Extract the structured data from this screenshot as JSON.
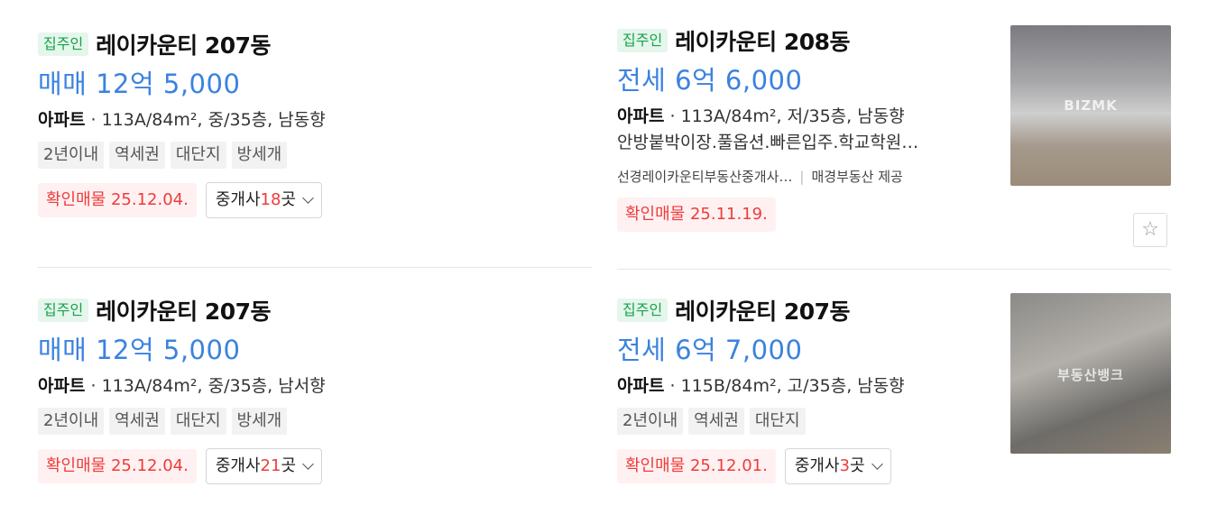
{
  "listings": [
    {
      "badge": "집주인",
      "title": "레이카운티 207동",
      "price": "매매 12억 5,000",
      "type": "아파트",
      "spec": "113A/84m², 중/35층, 남동향",
      "tags": [
        "2년이내",
        "역세권",
        "대단지",
        "방세개"
      ],
      "verified": "확인매물 25.12.04.",
      "brokers_prefix": "중개사 ",
      "brokers_count": "18",
      "brokers_suffix": "곳"
    },
    {
      "badge": "집주인",
      "title": "레이카운티 207동",
      "price": "매매 12억 5,000",
      "type": "아파트",
      "spec": "113A/84m², 중/35층, 남서향",
      "tags": [
        "2년이내",
        "역세권",
        "대단지",
        "방세개"
      ],
      "verified": "확인매물 25.12.04.",
      "brokers_prefix": "중개사 ",
      "brokers_count": "21",
      "brokers_suffix": "곳"
    },
    {
      "badge": "집주인",
      "title": "레이카운티 208동",
      "price": "전세 6억 6,000",
      "type": "아파트",
      "spec": "113A/84m², 저/35층, 남동향",
      "description": "안방붙박이장.풀옵션.빠른입주.학교학원…",
      "agent": "선경레이카운티부동산중개사…",
      "provider": "매경부동산 제공",
      "verified": "확인매물 25.11.19.",
      "thumb_watermark": "BIZMK"
    },
    {
      "badge": "집주인",
      "title": "레이카운티 207동",
      "price": "전세 6억 7,000",
      "type": "아파트",
      "spec": "115B/84m², 고/35층, 남동향",
      "tags": [
        "2년이내",
        "역세권",
        "대단지"
      ],
      "verified": "확인매물 25.12.01.",
      "brokers_prefix": "중개사 ",
      "brokers_count": "3",
      "brokers_suffix": "곳",
      "thumb_watermark": "부동산뱅크"
    }
  ],
  "icons": {
    "favorite": "star-outline-icon",
    "expand": "chevron-down-icon"
  },
  "colors": {
    "price": "#3b82e0",
    "verified": "#ef3b3b",
    "owner_badge": "#16a34a"
  }
}
